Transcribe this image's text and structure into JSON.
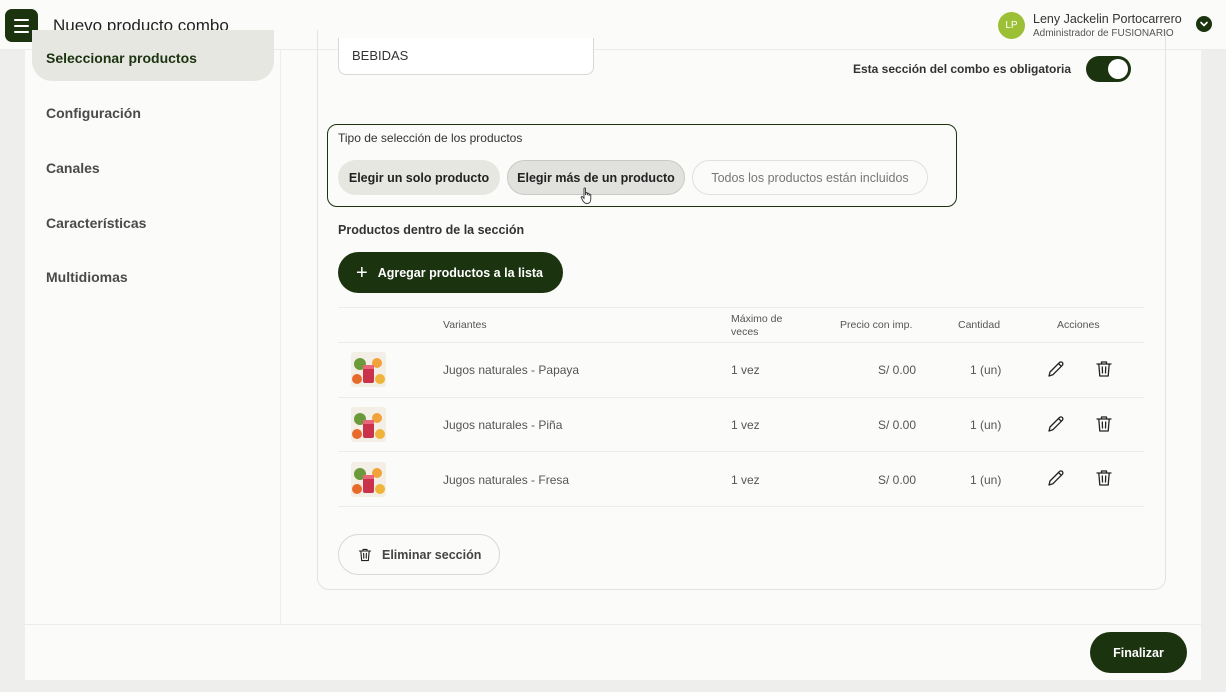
{
  "header": {
    "title": "Nuevo producto combo",
    "avatar_initials": "LP",
    "user_name": "Leny Jackelin Portocarrero",
    "user_role": "Administrador de FUSIONARIO"
  },
  "sidebar": {
    "items": [
      {
        "label": "Seleccionar productos",
        "active": true
      },
      {
        "label": "Configuración"
      },
      {
        "label": "Canales"
      },
      {
        "label": "Características"
      },
      {
        "label": "Multidiomas"
      }
    ]
  },
  "section": {
    "name_value": "BEBIDAS",
    "required_label": "Esta sección del combo es obligatoria",
    "required_on": true,
    "selection_title": "Tipo de selección de los productos",
    "selection_options": [
      "Elegir un solo producto",
      "Elegir más de un producto",
      "Todos los productos están incluidos"
    ],
    "products_label": "Productos dentro de la sección",
    "add_button": "Agregar productos a la lista",
    "delete_section": "Eliminar sección"
  },
  "table": {
    "headers": {
      "variants": "Variantes",
      "max_line1": "Máximo de",
      "max_line2": "veces",
      "price": "Precio con imp.",
      "qty": "Cantidad",
      "actions": "Acciones"
    },
    "rows": [
      {
        "variant": "Jugos naturales - Papaya",
        "max": "1 vez",
        "price": "S/ 0.00",
        "qty": "1 (un)"
      },
      {
        "variant": "Jugos naturales - Piña",
        "max": "1 vez",
        "price": "S/ 0.00",
        "qty": "1 (un)"
      },
      {
        "variant": "Jugos naturales - Fresa",
        "max": "1 vez",
        "price": "S/ 0.00",
        "qty": "1 (un)"
      }
    ]
  },
  "footer": {
    "finish_button": "Finalizar"
  },
  "colors": {
    "primary": "#1c3310",
    "avatar": "#9cc035",
    "active_bg": "#e6e7e1"
  }
}
